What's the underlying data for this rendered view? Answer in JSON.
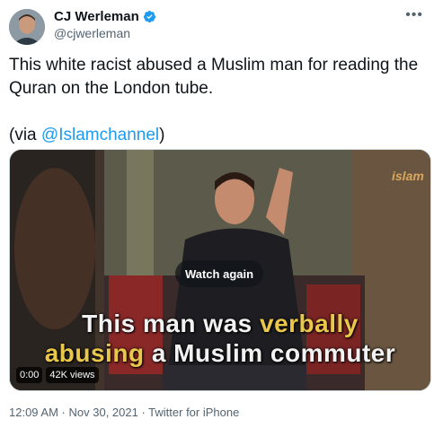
{
  "author": {
    "name": "CJ Werleman",
    "handle": "@cjwerleman",
    "verified": true
  },
  "more_icon": "more-horizontal-icon",
  "tweet": {
    "text": "This white racist abused a Muslim man for reading the Quran on the London tube.",
    "via_prefix": "(via ",
    "via_mention": "@Islamchannel",
    "via_suffix": ")"
  },
  "media": {
    "watch_again_label": "Watch again",
    "caption_line1_a": "This man was ",
    "caption_line1_b": "verbally",
    "caption_line2_a": "abusing",
    "caption_line2_b": " a Muslim commuter",
    "logo_text": "islam",
    "time": "0:00",
    "views": "42K views"
  },
  "meta": {
    "time": "12:09 AM",
    "separator": " · ",
    "date": "Nov 30, 2021",
    "source": "Twitter for iPhone"
  },
  "colors": {
    "link": "#1d9bf0",
    "verified": "#1d9bf0",
    "caption_highlight": "#e8c74a"
  }
}
